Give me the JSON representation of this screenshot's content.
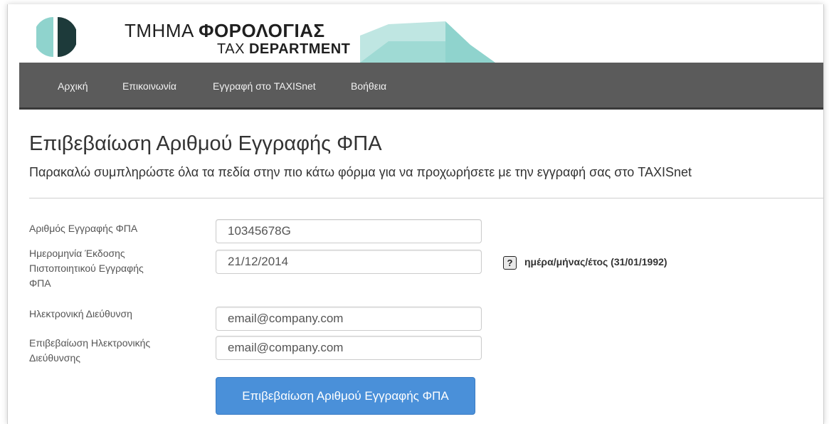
{
  "header": {
    "title_el_prefix": "ΤΜΗΜΑ ",
    "title_el_bold": "ΦΟΡΟΛΟΓΙΑΣ",
    "title_en_prefix": "TAX ",
    "title_en_bold": "DEPARTMENT",
    "logo_dark_color": "#1d3a3a",
    "logo_teal_color": "#8fd3cd"
  },
  "nav": {
    "items": [
      {
        "label": "Αρχική"
      },
      {
        "label": "Επικοινωνία"
      },
      {
        "label": "Εγγραφή στο TAXISnet"
      },
      {
        "label": "Βοήθεια"
      }
    ],
    "background_color": "#5b5b5b"
  },
  "main": {
    "title": "Επιβεβαίωση Αριθμού Εγγραφής ΦΠΑ",
    "subtitle": "Παρακαλώ συμπληρώστε όλα τα πεδία στην πιο κάτω φόρμα για να προχωρήσετε με την εγγραφή σας στο TAXISnet"
  },
  "form": {
    "vat_number": {
      "label": "Αριθμός Εγγραφής ΦΠΑ",
      "value": "10345678G"
    },
    "issue_date": {
      "label_line1": "Ημερομηνία Έκδοσης",
      "label_line2": "Πιστοποιητικού Εγγραφής",
      "label_line3": "ΦΠΑ",
      "value": "21/12/2014",
      "help_icon_glyph": "?",
      "help_text": "ημέρα/μήνας/έτος (31/01/1992)"
    },
    "email": {
      "label": "Ηλεκτρονική Διεύθυνση",
      "value": "email@company.com"
    },
    "email_confirm": {
      "label_line1": "Επιβεβαίωση Ηλεκτρονικής",
      "label_line2": "Διεύθυνσης",
      "value": "email@company.com"
    },
    "submit_label": "Επιβεβαίωση Αριθμού Εγγραφής ΦΠΑ",
    "submit_color": "#4a90d9"
  }
}
